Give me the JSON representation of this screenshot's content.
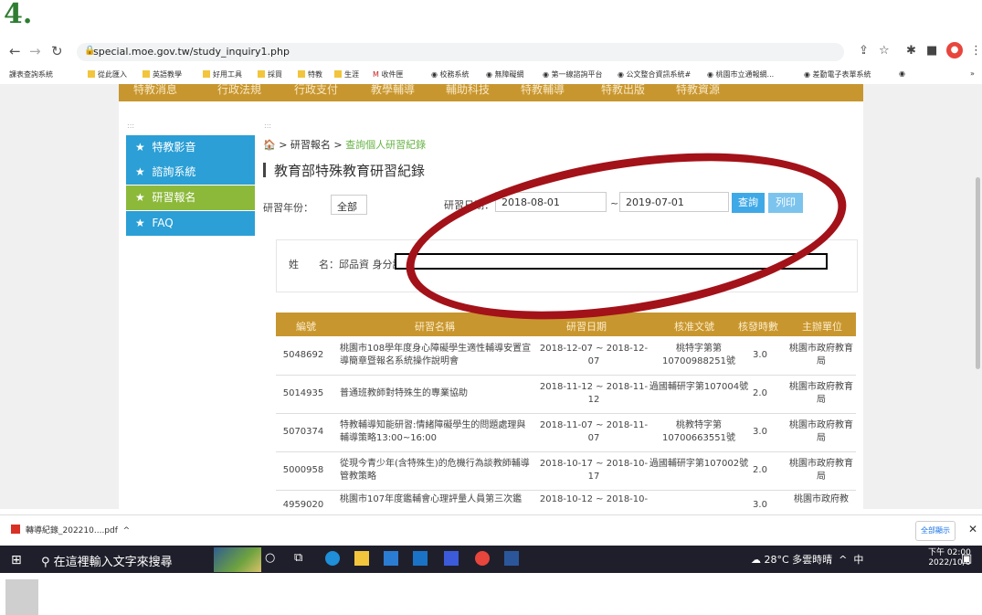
{
  "step": "4.",
  "browser": {
    "url": "special.moe.gov.tw/study_inquiry1.php",
    "bookmarks": [
      "課表查詢系統",
      "從此匯入",
      "英語教學",
      "好用工具",
      "採買",
      "特教",
      "生涯",
      "收件匣",
      "校務系統",
      "無障礙網",
      "第一線諮詢平台",
      "公文整合資訊系統#",
      "桃園市立通報網...",
      "差勤電子表單系統"
    ]
  },
  "site": {
    "top_nav": [
      "特教消息",
      "行政法規",
      "行政支付",
      "教學輔導",
      "輔助科技",
      "特教輔導",
      "特教出版",
      "特教資源"
    ],
    "sidebar": [
      {
        "label": "特教影音",
        "active": false
      },
      {
        "label": "諮詢系統",
        "active": false
      },
      {
        "label": "研習報名",
        "active": true
      },
      {
        "label": "FAQ",
        "active": false
      }
    ],
    "breadcrumb": {
      "parent": "研習報名 >",
      "current": "查詢個人研習紀錄"
    },
    "page_title": "教育部特殊教育研習紀錄",
    "filters": {
      "year_label": "研習年份：",
      "year_value": "全部",
      "date_label": "研習日期：",
      "date_from": "2018-08-01",
      "date_sep": "~",
      "date_to": "2019-07-01",
      "query_btn": "查詢",
      "print_btn": "列印"
    },
    "name_row": {
      "label": "姓　　名：邱品資 身分證"
    },
    "table": {
      "headers": [
        "編號",
        "研習名稱",
        "研習日期",
        "核准文號",
        "核發時數",
        "主辦單位"
      ],
      "rows": [
        {
          "id": "5048692",
          "name": "桃園市108學年度身心障礙學生適性輔導安置宣導簡章暨報名系統操作說明會",
          "date": "2018-12-07 ~ 2018-12-07",
          "doc": "桃特字第第10700988251號",
          "hours": "3.0",
          "org": "桃園市政府教育局"
        },
        {
          "id": "5014935",
          "name": "普通班教師對特殊生的專業協助",
          "date": "2018-11-12 ~ 2018-11-12",
          "doc": "過國輔研字第107004號",
          "hours": "2.0",
          "org": "桃園市政府教育局"
        },
        {
          "id": "5070374",
          "name": "特教輔導知能研習:情緒障礙學生的問題處理與輔導策略13:00~16:00",
          "date": "2018-11-07 ~ 2018-11-07",
          "doc": "桃教特字第10700663551號",
          "hours": "3.0",
          "org": "桃園市政府教育局"
        },
        {
          "id": "5000958",
          "name": "從現今青少年(含特殊生)的危機行為談教師輔導管教策略",
          "date": "2018-10-17 ~ 2018-10-17",
          "doc": "過國輔研字第107002號",
          "hours": "2.0",
          "org": "桃園市政府教育局"
        },
        {
          "id": "4959020",
          "name": "桃園市107年度鑑輔會心理評量人員第三次鑑",
          "date": "2018-10-12 ~ 2018-10-",
          "doc": "",
          "hours": "3.0",
          "org": "桃園市政府教"
        }
      ]
    }
  },
  "download_bar": {
    "file": "轉導紀錄_202210....pdf",
    "show_all": "全部顯示"
  },
  "taskbar": {
    "search_placeholder": "在這裡輸入文字來搜尋",
    "weather": "28°C 多雲時晴",
    "ime": "中",
    "time": "下午 02:00",
    "date": "2022/10/6"
  },
  "colors": {
    "accent_gold": "#c8962f",
    "sidebar_blue": "#2b9fd6",
    "sidebar_green": "#8cb93a",
    "annotation_red": "#a31219",
    "step_green": "#2e7d32"
  }
}
